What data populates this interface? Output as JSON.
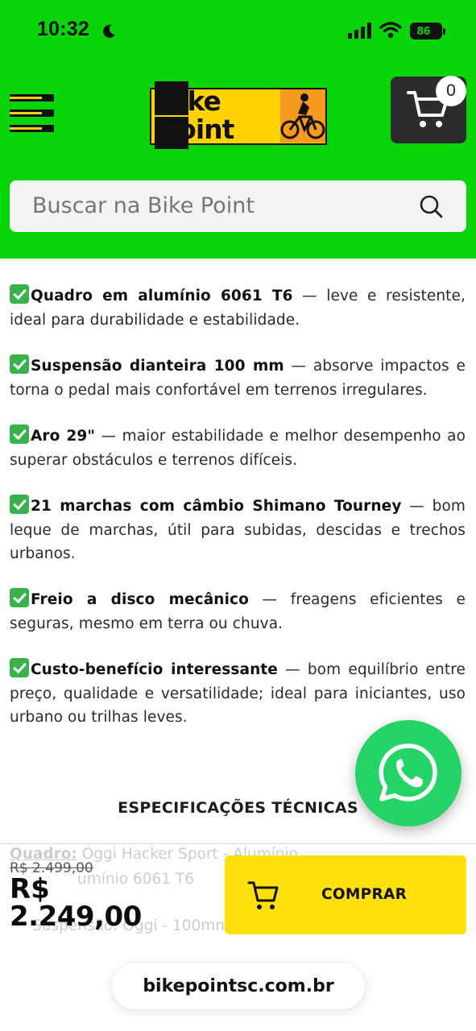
{
  "status_bar": {
    "time": "10:32",
    "battery": "86"
  },
  "header": {
    "logo_line1": "Bike",
    "logo_line2": "Point",
    "cart_count": "0",
    "search_placeholder": "Buscar na Bike Point",
    "colors": {
      "header_bg": "#07d507",
      "cart_bg": "#2c2c2c",
      "accent_yellow": "#ffd200"
    }
  },
  "features": [
    {
      "icon": "check-mark-icon",
      "bold": "Quadro em alumínio 6061 T6",
      "text": " — leve e resistente, ideal para durabilidade e estabilidade."
    },
    {
      "icon": "check-mark-icon",
      "bold": "Suspensão dianteira 100 mm",
      "text": " — absorve impactos e torna o pedal mais confortável em terrenos irregulares."
    },
    {
      "icon": "check-mark-icon",
      "bold": "Aro 29\"",
      "text": " — maior estabilidade e melhor desempenho ao superar obstáculos e terrenos difíceis."
    },
    {
      "icon": "check-mark-icon",
      "bold": "21 marchas com câmbio Shimano Tourney",
      "text": " — bom leque de marchas, útil para subidas, descidas e trechos urbanos."
    },
    {
      "icon": "check-mark-icon",
      "bold": "Freio a disco mecânico",
      "text": " — freagens eficientes e seguras, mesmo em terra ou chuva."
    },
    {
      "icon": "check-mark-icon",
      "bold": "Custo-benefício interessante",
      "text": " — bom equilíbrio entre preço, qualidade e versatilidade; ideal para iniciantes, uso urbano ou trilhas leves."
    }
  ],
  "spec_section": {
    "title": "ESPECIFICAÇÕES TÉCNICAS",
    "ghost_line1_bold": "Quadro:",
    "ghost_line1": " Oggi Hacker Sport - Alumínio",
    "ghost_line2": "umínio 6061 T6",
    "ghost_line3": "Suspensão: Oggi - 100mm"
  },
  "purchase": {
    "old_price": "R$ 2.499,00",
    "currency": "R$",
    "price": "2.249,00",
    "buy_label": "COMPRAR",
    "buy_color": "#ffe00a"
  },
  "whatsapp": {
    "icon": "whatsapp-icon",
    "color": "#25d366"
  },
  "browser": {
    "url": "bikepointsc.com.br"
  }
}
